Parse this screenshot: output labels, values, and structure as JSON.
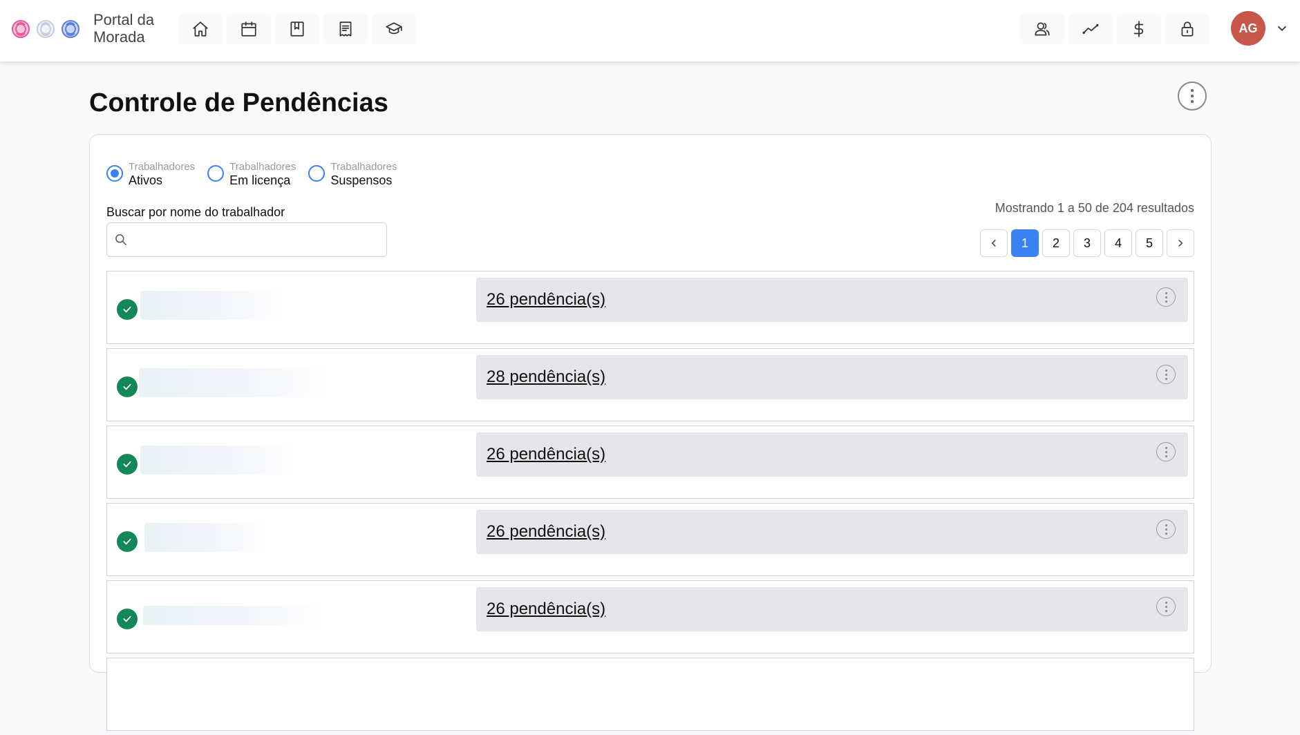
{
  "app": {
    "brand": "Portal da Morada",
    "user_initials": "AG",
    "colors": {
      "accent": "#3b82f6",
      "avatar": "#c8574b",
      "status_ok": "#13875b",
      "logo_rose_pink": "#e9559b",
      "logo_rose_white": "#d7d9e6",
      "logo_rose_blue": "#5a7fd6"
    }
  },
  "nav": {
    "left": [
      {
        "icon": "home-icon"
      },
      {
        "icon": "calendar-icon"
      },
      {
        "icon": "bookmark-book-icon"
      },
      {
        "icon": "receipt-icon"
      },
      {
        "icon": "graduation-cap-icon"
      }
    ],
    "right": [
      {
        "icon": "users-icon"
      },
      {
        "icon": "trend-chart-icon"
      },
      {
        "icon": "dollar-icon"
      },
      {
        "icon": "lock-icon"
      }
    ]
  },
  "page": {
    "title": "Controle de Pendências"
  },
  "filters": {
    "options": [
      {
        "small": "Trabalhadores",
        "main": "Ativos",
        "checked": true
      },
      {
        "small": "Trabalhadores",
        "main": "Em licença",
        "checked": false
      },
      {
        "small": "Trabalhadores",
        "main": "Suspensos",
        "checked": false
      }
    ]
  },
  "search": {
    "label": "Buscar por nome do trabalhador",
    "value": "",
    "placeholder": ""
  },
  "results": {
    "text": "Mostrando 1 a 50 de 204 resultados"
  },
  "pagination": {
    "pages": [
      "1",
      "2",
      "3",
      "4",
      "5"
    ],
    "current": "1"
  },
  "rows": [
    {
      "pendencias": "26 pendência(s)"
    },
    {
      "pendencias": "28 pendência(s)"
    },
    {
      "pendencias": "26 pendência(s)"
    },
    {
      "pendencias": "26 pendência(s)"
    },
    {
      "pendencias": "26 pendência(s)"
    }
  ]
}
